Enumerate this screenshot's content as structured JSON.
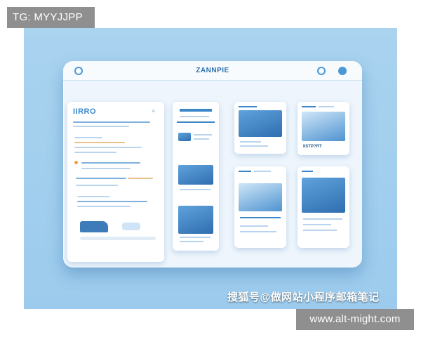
{
  "overlays": {
    "top_left_tag": "TG: MYYJJPP",
    "bottom_right_tag": "www.alt-might.com"
  },
  "illustration": {
    "background_color": "#a9d3ef",
    "accent_color": "#3a86c8",
    "window": {
      "title": "ZANNPIE",
      "left_icon": "circle-icon",
      "right_icons": [
        "check-circle-icon",
        "settings-circle-icon"
      ]
    },
    "left_panel": {
      "title": "IIRRO",
      "close_glyph": "×"
    },
    "cards": {
      "card_2": {
        "code": "IISTP?RT"
      }
    },
    "watermark": "搜狐号@做网站小程序邮箱笔记"
  }
}
